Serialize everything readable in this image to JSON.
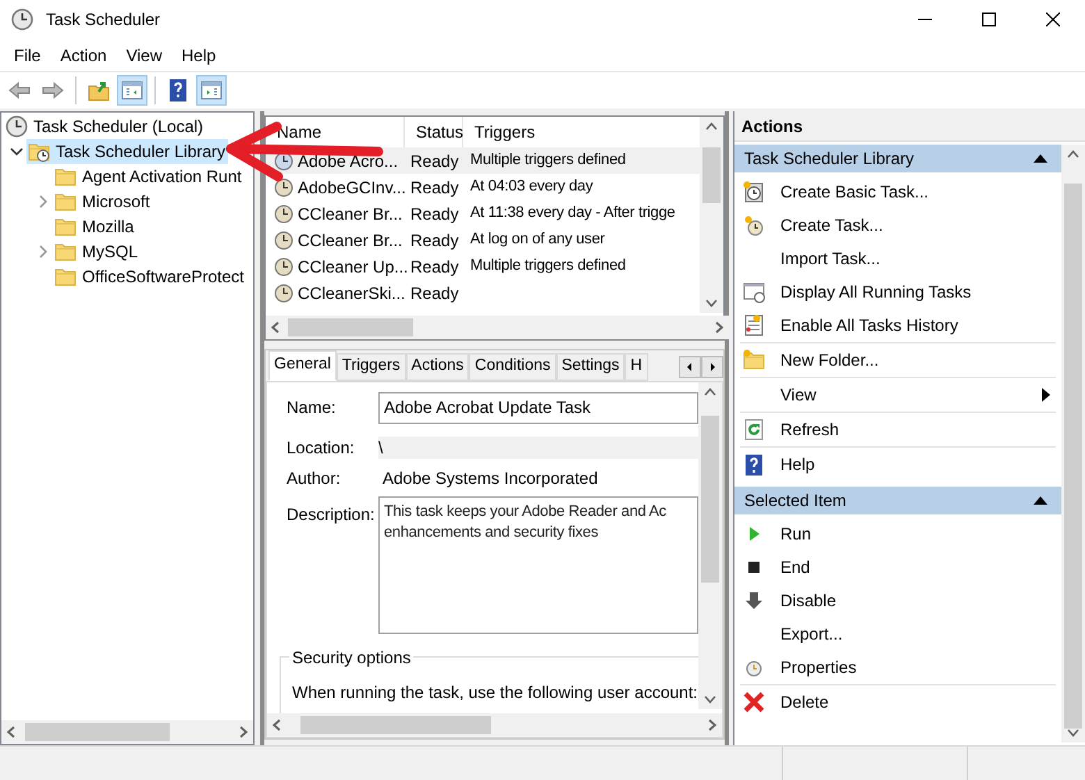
{
  "window": {
    "title": "Task Scheduler"
  },
  "menu": [
    "File",
    "Action",
    "View",
    "Help"
  ],
  "toolbar": [
    {
      "kind": "back",
      "pressed": false
    },
    {
      "kind": "forward",
      "pressed": false
    },
    {
      "kind": "up",
      "pressed": false
    },
    {
      "kind": "treepane",
      "pressed": true
    },
    {
      "kind": "help",
      "pressed": false
    },
    {
      "kind": "actionpane",
      "pressed": true
    }
  ],
  "tree": [
    {
      "label": "Task Scheduler (Local)",
      "expandable": false,
      "selected": false,
      "children": [
        {
          "label": "Task Scheduler Library",
          "expandable": true,
          "expanded": true,
          "selected": true,
          "children": [
            {
              "label": "Agent Activation Runt",
              "expandable": false,
              "selected": false
            },
            {
              "label": "Microsoft",
              "expandable": true,
              "expanded": false,
              "selected": false
            },
            {
              "label": "Mozilla",
              "expandable": false,
              "selected": false
            },
            {
              "label": "MySQL",
              "expandable": true,
              "expanded": false,
              "selected": false
            },
            {
              "label": "OfficeSoftwareProtect",
              "expandable": false,
              "selected": false
            }
          ]
        }
      ]
    }
  ],
  "task_list": {
    "columns": [
      "Name",
      "Status",
      "Triggers"
    ],
    "rows": [
      {
        "name": "Adobe Acro...",
        "status": "Ready",
        "triggers": "Multiple triggers defined",
        "selected": true
      },
      {
        "name": "AdobeGCInv...",
        "status": "Ready",
        "triggers": "At 04:03 every day",
        "selected": false
      },
      {
        "name": "CCleaner Br...",
        "status": "Ready",
        "triggers": "At 11:38 every day - After trigge",
        "selected": false
      },
      {
        "name": "CCleaner Br...",
        "status": "Ready",
        "triggers": "At log on of any user",
        "selected": false
      },
      {
        "name": "CCleaner Up...",
        "status": "Ready",
        "triggers": "Multiple triggers defined",
        "selected": false
      },
      {
        "name": "CCleanerSki...",
        "status": "Ready",
        "selected": false
      }
    ]
  },
  "details": {
    "tabs": [
      {
        "label": "General",
        "selected": true
      },
      {
        "label": "Triggers",
        "selected": false
      },
      {
        "label": "Actions",
        "selected": false
      },
      {
        "label": "Conditions",
        "selected": false
      },
      {
        "label": "Settings",
        "selected": false
      },
      {
        "label": "H",
        "selected": false
      }
    ],
    "name_label": "Name:",
    "name_value": "Adobe Acrobat Update Task",
    "location_label": "Location:",
    "location_value": "\\",
    "author_label": "Author:",
    "author_value": "Adobe Systems Incorporated",
    "description_label": "Description:",
    "description_value": "This task keeps your Adobe Reader and Ac\nenhancements and security fixes",
    "security_group": "Security options",
    "security_text": "When running the task, use the following user account:"
  },
  "actions": {
    "title": "Actions",
    "sections": [
      {
        "title": "Task Scheduler Library",
        "groups": [
          [
            {
              "label": "Create Basic Task...",
              "kind": "command"
            },
            {
              "label": "Create Task...",
              "kind": "command"
            },
            {
              "label": "Import Task...",
              "kind": "command"
            },
            {
              "label": "Display All Running Tasks",
              "kind": "command"
            },
            {
              "label": "Enable All Tasks History",
              "kind": "command"
            }
          ],
          [
            {
              "label": "New Folder...",
              "kind": "command"
            }
          ],
          [
            {
              "label": "View",
              "kind": "submenu"
            }
          ],
          [
            {
              "label": "Refresh",
              "kind": "command"
            }
          ],
          [
            {
              "label": "Help",
              "kind": "command"
            }
          ]
        ]
      },
      {
        "title": "Selected Item",
        "groups": [
          [
            {
              "label": "Run",
              "kind": "command"
            },
            {
              "label": "End",
              "kind": "command"
            },
            {
              "label": "Disable",
              "kind": "command"
            },
            {
              "label": "Export...",
              "kind": "command"
            },
            {
              "label": "Properties",
              "kind": "command"
            }
          ],
          [
            {
              "label": "Delete",
              "kind": "command"
            }
          ]
        ]
      }
    ]
  },
  "annotations": [
    {
      "kind": "arrow",
      "color": "#e41e26"
    }
  ]
}
